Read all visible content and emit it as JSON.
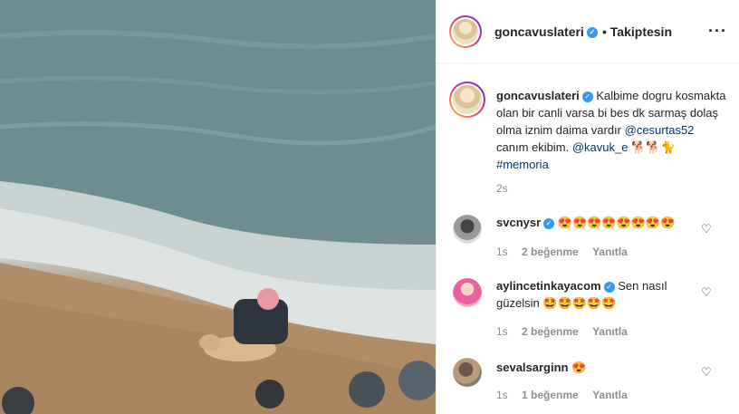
{
  "post": {
    "username": "goncavuslateri",
    "follow_status": "Takiptesin",
    "more_icon": "more-horizontal-icon"
  },
  "caption": {
    "username": "goncavuslateri",
    "text_1": "Kalbime dogru kosmakta olan bir canli varsa bi bes dk sarmaş dolaş olma iznim daima vardır",
    "mention_1": "@cesurtas52",
    "text_2": "canım ekibim.",
    "mention_2": "@kavuk_e",
    "text_3": "🐕🐕🐈",
    "hashtag": "#memoria",
    "time": "2s"
  },
  "comments": [
    {
      "username": "svcnysr",
      "verified": true,
      "text": "😍😍😍😍😍😍😍😍",
      "time": "1s",
      "likes": "2 beğenme",
      "reply": "Yanıtla"
    },
    {
      "username": "aylincetinkayacom",
      "verified": true,
      "text": "Sen nasıl güzelsin 🤩🤩🤩🤩🤩",
      "time": "1s",
      "likes": "2 beğenme",
      "reply": "Yanıtla"
    },
    {
      "username": "sevalsarginn",
      "verified": false,
      "text": "😍",
      "time": "1s",
      "likes": "1 beğenme",
      "reply": "Yanıtla"
    }
  ],
  "colors": {
    "verified": "#3897f0",
    "link": "#00376b",
    "muted": "#8e8e8e"
  }
}
